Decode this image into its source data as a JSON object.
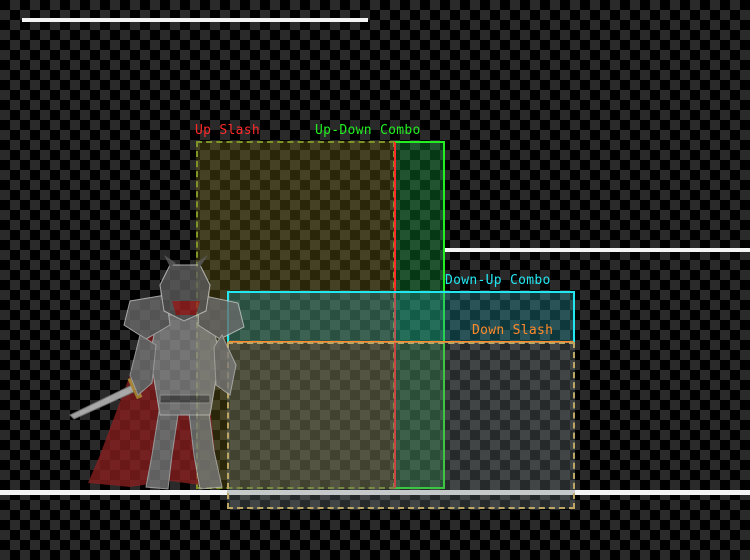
{
  "scene": {
    "background": "checkerboard",
    "colors": {
      "checker_dark": "#000000",
      "checker_light": "#2a2a2a",
      "platform": "#f4f4f4"
    }
  },
  "hitboxes": [
    {
      "id": "up-slash",
      "label": "Up Slash",
      "color": "#ff2a2a",
      "style": "dashed-red-green"
    },
    {
      "id": "up-down-combo",
      "label": "Up-Down Combo",
      "color": "#22ee22",
      "style": "solid"
    },
    {
      "id": "down-up-combo",
      "label": "Down-Up Combo",
      "color": "#22e6f0",
      "style": "solid"
    },
    {
      "id": "down-slash",
      "label": "Down Slash",
      "color": "#ff8a2a",
      "style": "dashed-orange-cyan"
    }
  ],
  "character": {
    "icon": "armored-knight-sprite",
    "colors": {
      "armor": "#8a8a8a",
      "cape": "#8a1f1f",
      "sword": "#cfcfcf",
      "sword_hilt": "#c9a13a"
    }
  }
}
